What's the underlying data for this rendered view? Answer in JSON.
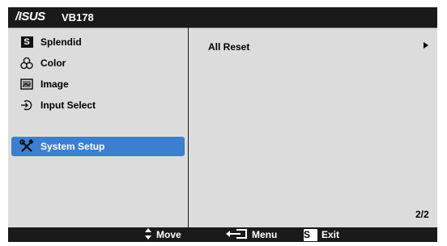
{
  "title": {
    "brand": "/ISUS",
    "model": "VB178"
  },
  "sidebar": {
    "items": [
      {
        "label": "Splendid",
        "icon": "splendid-s-icon"
      },
      {
        "label": "Color",
        "icon": "color-icon"
      },
      {
        "label": "Image",
        "icon": "image-icon"
      },
      {
        "label": "Input Select",
        "icon": "input-select-icon"
      },
      {
        "label": "System Setup",
        "icon": "system-setup-icon",
        "selected": true
      }
    ]
  },
  "content": {
    "option": "All Reset",
    "page": "2/2"
  },
  "footer": {
    "move": "Move",
    "menu": "Menu",
    "exit": "Exit",
    "exit_badge": "S"
  },
  "colors": {
    "selected": "#3c7fd0",
    "panel": "#dcdcdc",
    "frame": "#1a1a1a"
  }
}
